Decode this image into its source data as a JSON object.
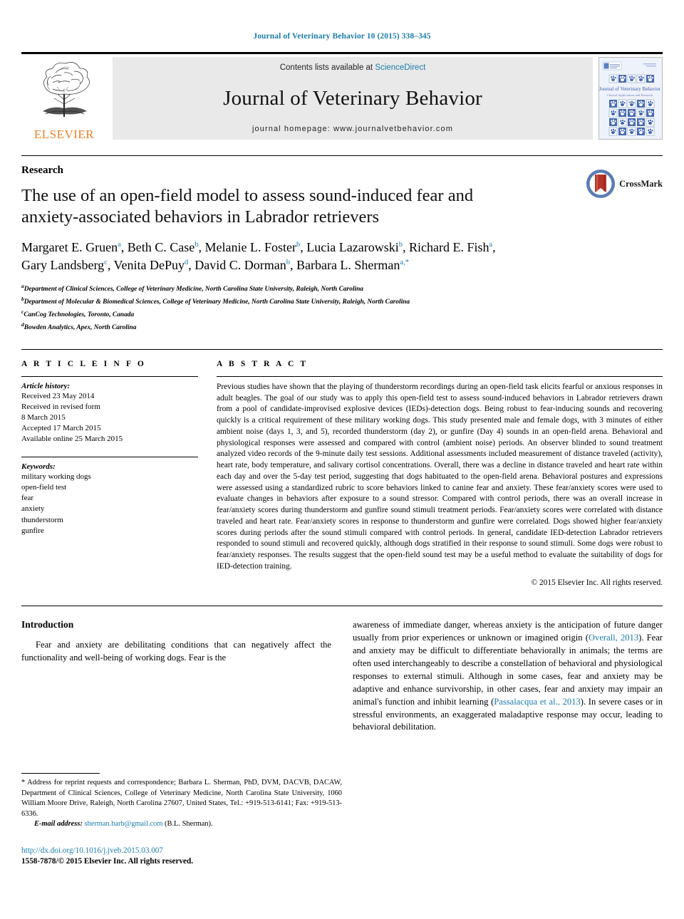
{
  "running_head": "Journal of Veterinary Behavior 10 (2015) 338–345",
  "masthead": {
    "publisher_name": "ELSEVIER",
    "contents_prefix": "Contents lists available at ",
    "sciencedirect": "ScienceDirect",
    "journal_title": "Journal of Veterinary Behavior",
    "homepage": "journal homepage: www.journalvetbehavior.com",
    "cover_title": "Journal of Veterinary Behavior",
    "cover_subtitle": "Clinical Applications and Research"
  },
  "article": {
    "kind": "Research",
    "title": "The use of an open-field model to assess sound-induced fear and anxiety-associated behaviors in Labrador retrievers",
    "crossmark_label": "CrossMark",
    "authors": [
      {
        "name": "Margaret E. Gruen",
        "sup": "a",
        "sep": ", "
      },
      {
        "name": "Beth C. Case",
        "sup": "b",
        "sep": ", "
      },
      {
        "name": "Melanie L. Foster",
        "sup": "b",
        "sep": ", "
      },
      {
        "name": "Lucia Lazarowski",
        "sup": "b",
        "sep": ", "
      },
      {
        "name": "Richard E. Fish",
        "sup": "a",
        "sep": ", "
      },
      {
        "name": "Gary Landsberg",
        "sup": "c",
        "sep": ", "
      },
      {
        "name": "Venita DePuy",
        "sup": "d",
        "sep": ", "
      },
      {
        "name": "David C. Dorman",
        "sup": "b",
        "sep": ", "
      },
      {
        "name": "Barbara L. Sherman",
        "sup": "a,*",
        "sep": ""
      }
    ],
    "affiliations": [
      {
        "sup": "a",
        "text": "Department of Clinical Sciences, College of Veterinary Medicine, North Carolina State University, Raleigh, North Carolina"
      },
      {
        "sup": "b",
        "text": "Department of Molecular & Biomedical Sciences, College of Veterinary Medicine, North Carolina State University, Raleigh, North Carolina"
      },
      {
        "sup": "c",
        "text": "CanCog Technologies, Toronto, Canada"
      },
      {
        "sup": "d",
        "text": "Bowden Analytics, Apex, North Carolina"
      }
    ]
  },
  "info": {
    "heading": "A R T I C L E  I N F O",
    "history_label": "Article history:",
    "history": [
      "Received 23 May 2014",
      "Received in revised form",
      "8 March 2015",
      "Accepted 17 March 2015",
      "Available online 25 March 2015"
    ],
    "keywords_label": "Keywords:",
    "keywords": [
      "military working dogs",
      "open-field test",
      "fear",
      "anxiety",
      "thunderstorm",
      "gunfire"
    ]
  },
  "abstract": {
    "heading": "A B S T R A C T",
    "text": "Previous studies have shown that the playing of thunderstorm recordings during an open-field task elicits fearful or anxious responses in adult beagles. The goal of our study was to apply this open-field test to assess sound-induced behaviors in Labrador retrievers drawn from a pool of candidate-improvised explosive devices (IEDs)-detection dogs. Being robust to fear-inducing sounds and recovering quickly is a critical requirement of these military working dogs. This study presented male and female dogs, with 3 minutes of either ambient noise (days 1, 3, and 5), recorded thunderstorm (day 2), or gunfire (Day 4) sounds in an open-field arena. Behavioral and physiological responses were assessed and compared with control (ambient noise) periods. An observer blinded to sound treatment analyzed video records of the 9-minute daily test sessions. Additional assessments included measurement of distance traveled (activity), heart rate, body temperature, and salivary cortisol concentrations. Overall, there was a decline in distance traveled and heart rate within each day and over the 5-day test period, suggesting that dogs habituated to the open-field arena. Behavioral postures and expressions were assessed using a standardized rubric to score behaviors linked to canine fear and anxiety. These fear/anxiety scores were used to evaluate changes in behaviors after exposure to a sound stressor. Compared with control periods, there was an overall increase in fear/anxiety scores during thunderstorm and gunfire sound stimuli treatment periods. Fear/anxiety scores were correlated with distance traveled and heart rate. Fear/anxiety scores in response to thunderstorm and gunfire were correlated. Dogs showed higher fear/anxiety scores during periods after the sound stimuli compared with control periods. In general, candidate IED-detection Labrador retrievers responded to sound stimuli and recovered quickly, although dogs stratified in their response to sound stimuli. Some dogs were robust to fear/anxiety responses. The results suggest that the open-field sound test may be a useful method to evaluate the suitability of dogs for IED-detection training.",
    "copyright": "© 2015 Elsevier Inc. All rights reserved."
  },
  "body": {
    "intro_heading": "Introduction",
    "left_para": "Fear and anxiety are debilitating conditions that can negatively affect the functionality and well-being of working dogs. Fear is the",
    "right_para_1": "awareness of immediate danger, whereas anxiety is the anticipation of future danger usually from prior experiences or unknown or imagined origin (",
    "right_cite_1": "Overall, 2013",
    "right_para_2": "). Fear and anxiety may be difficult to differentiate behaviorally in animals; the terms are often used interchangeably to describe a constellation of behavioral and physiological responses to external stimuli. Although in some cases, fear and anxiety may be adaptive and enhance survivorship, in other cases, fear and anxiety may impair an animal's function and inhibit learning (",
    "right_cite_2": "Passalacqua et al., 2013",
    "right_para_3": "). In severe cases or in stressful environments, an exaggerated maladaptive response may occur, leading to behavioral debilitation."
  },
  "footnote": {
    "text": "* Address for reprint requests and correspondence; Barbara L. Sherman, PhD, DVM, DACVB, DACAW, Department of Clinical Sciences, College of Veterinary Medicine, North Carolina State University, 1060 William Moore Drive, Raleigh, North Carolina 27607, United States, Tel.: +919-513-6141; Fax: +919-513-6336.",
    "email_label": "E-mail address:",
    "email": "sherman.barb@gmail.com",
    "email_attrib": "(B.L. Sherman).",
    "doi": "http://dx.doi.org/10.1016/j.jveb.2015.03.007",
    "issn": "1558-7878/© 2015 Elsevier Inc. All rights reserved."
  },
  "colors": {
    "link_blue": "#1c7cab",
    "elsevier_orange": "#ef7c22",
    "banner_gray": "#e9e9e9",
    "crossmark_red": "#b5342a",
    "crossmark_blue": "#4a6fa8"
  }
}
